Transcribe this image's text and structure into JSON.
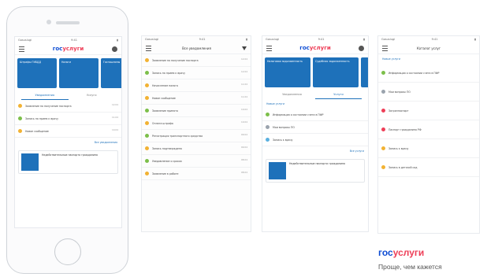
{
  "status_bar": {
    "carrier": "Gosuslugi",
    "time": "9:41"
  },
  "brand": {
    "part1": "гос",
    "part2": "услуги",
    "tagline": "Проще, чем кажется"
  },
  "screen1": {
    "logo1": "гос",
    "logo2": "услуги",
    "cards": [
      "Штрафы ГИБДД",
      "Налоги",
      "Госпошлины"
    ],
    "tabs": [
      "Уведомления",
      "Услуги"
    ],
    "rows": [
      {
        "text": "Заявление на получение паспорта",
        "date": "12.04"
      },
      {
        "text": "Запись на прием к врачу",
        "date": "11.04"
      },
      {
        "text": "Новое сообщение",
        "date": "10.04"
      }
    ],
    "more": "Все уведомления",
    "promo": "Недействительные паспорта гражданина"
  },
  "screen2": {
    "title": "Все уведомления",
    "rows": [
      {
        "text": "Заявление на получение паспорта",
        "date": "12.04"
      },
      {
        "text": "Запись на прием к врачу",
        "date": "12.04"
      },
      {
        "text": "Начисление налога",
        "date": "11.04"
      },
      {
        "text": "Новое сообщение",
        "date": "11.04"
      },
      {
        "text": "Заявление принято",
        "date": "10.04"
      },
      {
        "text": "Оплата штрафа",
        "date": "10.04"
      },
      {
        "text": "Регистрация транспортного средства",
        "date": "09.04"
      },
      {
        "text": "Запись подтверждена",
        "date": "09.04"
      },
      {
        "text": "Уведомление о сроках",
        "date": "08.04"
      },
      {
        "text": "Заявление в работе",
        "date": "08.04"
      }
    ]
  },
  "screen3": {
    "logo1": "гос",
    "logo2": "услуги",
    "cards": [
      "Налоговая задолженность",
      "Судебная задолженность"
    ],
    "tabs": [
      "Уведомления",
      "Услуги"
    ],
    "section": "Новые услуги",
    "rows": [
      {
        "text": "Информация о состоянии счета в ПФР"
      },
      {
        "text": "Мои вопросы ПО"
      },
      {
        "text": "Запись к врачу"
      }
    ],
    "more": "Все услуги",
    "promo": "Недействительные паспорта гражданина"
  },
  "screen4": {
    "title": "Каталог услуг",
    "section": "Новые услуги",
    "rows": [
      {
        "text": "Информация о состоянии счета в ПФР"
      },
      {
        "text": "Мои вопросы ПО"
      },
      {
        "text": "Загранпаспорт"
      },
      {
        "text": "Паспорт гражданина РФ"
      },
      {
        "text": "Запись к врачу"
      },
      {
        "text": "Запись в детский сад"
      }
    ]
  },
  "colors": {
    "brand_blue": "#0d4cd3",
    "brand_red": "#ee3f58",
    "card_blue": "#1e71ba"
  }
}
